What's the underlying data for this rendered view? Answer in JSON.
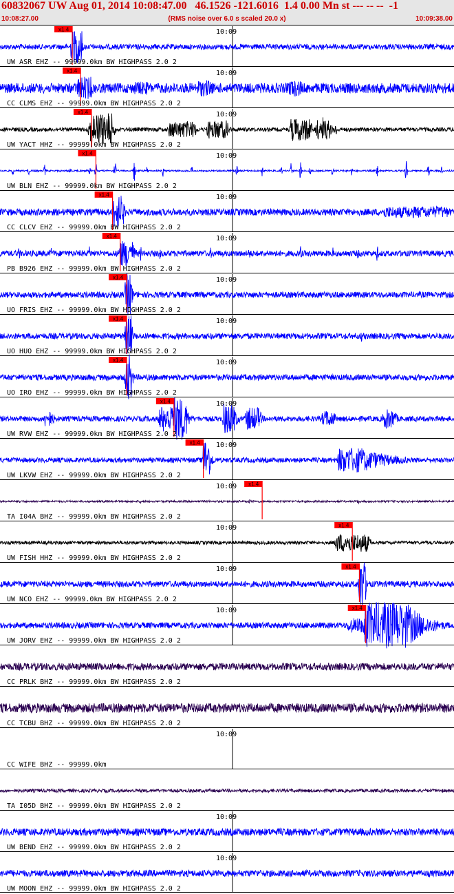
{
  "header": {
    "title": "60832067 UW Aug 01, 2014 10:08:47.00   46.1526 -121.6016  1.4 0.00 Mn st --- -- --  -1",
    "start_time": "10:08:27.00",
    "subtitle": "(RMS noise over 6.0 s scaled 20.0 x)",
    "end_time": "10:09:38.00"
  },
  "colors": {
    "trace_blue": "#0000ff",
    "trace_black": "#000000",
    "trace_purple": "#2a0050",
    "pick_red": "#ff0000",
    "header_text": "#cc0000"
  },
  "chart_data": {
    "type": "line",
    "x_unit": "time",
    "x_start": "10:08:27.00",
    "x_end": "10:09:38.00",
    "minute_mark_label": "10:09",
    "traces": [
      {
        "label": "UW ASR EHZ -- 99999.0km BW  HIGHPASS  2.0  2",
        "color": "blue",
        "pick": "x1.4",
        "pick_time_s": 11.3,
        "noise": 0.16,
        "bursts": [
          [
            11.2,
            1.6,
            1.0,
            6
          ]
        ],
        "spikes": []
      },
      {
        "label": "CC CLMS EHZ -- 99999.0km BW  HIGHPASS  2.0  2",
        "color": "blue",
        "pick": "x1.4",
        "pick_time_s": 12.6,
        "noise": 0.3,
        "bursts": [
          [
            12.2,
            2.0,
            0.7,
            2
          ],
          [
            21,
            2,
            0.4,
            1.5
          ],
          [
            31,
            2,
            0.5,
            1.5
          ],
          [
            45,
            2,
            0.5,
            1.5
          ]
        ],
        "spikes": []
      },
      {
        "label": "UW YACT HHZ -- 99999.0km BW  HIGHPASS  2.0  2",
        "color": "black",
        "pick": "x1.4",
        "pick_time_s": 14.3,
        "noise": 0.12,
        "bursts": [
          [
            14.0,
            3.5,
            1.0,
            2.5
          ],
          [
            26.5,
            4.0,
            0.5,
            3
          ],
          [
            32.5,
            3.0,
            0.55,
            2
          ],
          [
            45.5,
            3.0,
            0.7,
            3
          ],
          [
            49.5,
            2.0,
            0.6,
            2
          ]
        ],
        "spikes": [
          [
            50.5,
            0.9
          ],
          [
            52.5,
            0.6
          ]
        ]
      },
      {
        "label": "UW BLN EHZ -- 99999.0km BW  HIGHPASS  2.0  2",
        "color": "blue",
        "pick": "x1.4",
        "pick_time_s": 15.0,
        "noise": 0.05,
        "bursts": [],
        "spikes": [
          [
            2,
            0.3
          ],
          [
            4.5,
            0.3
          ],
          [
            7,
            0.4
          ],
          [
            11,
            0.3
          ],
          [
            14,
            0.3
          ],
          [
            15,
            0.6
          ],
          [
            18,
            0.8
          ],
          [
            21,
            0.8
          ],
          [
            23,
            0.3
          ],
          [
            25.5,
            0.4
          ],
          [
            30,
            0.3
          ],
          [
            37,
            0.4
          ],
          [
            41,
            0.4
          ],
          [
            44,
            0.3
          ],
          [
            45.5,
            0.5
          ],
          [
            47,
            0.7
          ],
          [
            48.5,
            0.4
          ],
          [
            52,
            0.4
          ],
          [
            55,
            0.3
          ],
          [
            59,
            0.6
          ],
          [
            63.5,
            1.0
          ],
          [
            67,
            0.5
          ],
          [
            69,
            0.4
          ]
        ]
      },
      {
        "label": "CC CLCV EHZ -- 99999.0km BW  HIGHPASS  2.0  2",
        "color": "blue",
        "pick": "x1.4",
        "pick_time_s": 17.6,
        "noise": 0.2,
        "bursts": [
          [
            17.7,
            1.5,
            1.0,
            3
          ],
          [
            60,
            10,
            0.35,
            5
          ]
        ],
        "spikes": []
      },
      {
        "label": "PB B926 EHZ -- 99999.0km BW  HIGHPASS  2.0  2",
        "color": "blue",
        "pick": "x1.4",
        "pick_time_s": 18.8,
        "noise": 0.18,
        "bursts": [
          [
            18.7,
            2.0,
            0.8,
            2
          ]
        ],
        "spikes": [
          [
            3,
            0.5
          ],
          [
            8,
            0.4
          ],
          [
            14,
            0.6
          ],
          [
            22,
            0.5
          ],
          [
            25,
            0.5
          ],
          [
            28,
            0.4
          ],
          [
            33,
            0.4
          ],
          [
            39,
            0.5
          ],
          [
            43,
            0.4
          ],
          [
            47,
            0.6
          ],
          [
            52,
            0.5
          ],
          [
            56,
            0.4
          ],
          [
            59,
            0.6
          ],
          [
            63,
            0.4
          ]
        ]
      },
      {
        "label": "UO FRIS EHZ -- 99999.0km BW  HIGHPASS  2.0  2",
        "color": "blue",
        "pick": "x1.4",
        "pick_time_s": 19.8,
        "noise": 0.18,
        "bursts": [
          [
            19.7,
            0.8,
            1.3,
            4
          ]
        ],
        "spikes": []
      },
      {
        "label": "UO HUO EHZ -- 99999.0km BW  HIGHPASS  2.0  2",
        "color": "blue",
        "pick": "x1.4",
        "pick_time_s": 19.8,
        "noise": 0.18,
        "bursts": [
          [
            19.7,
            0.8,
            1.3,
            4
          ]
        ],
        "spikes": [
          [
            56.5,
            0.4
          ]
        ]
      },
      {
        "label": "UO IRO EHZ -- 99999.0km BW  HIGHPASS  2.0  2",
        "color": "blue",
        "pick": "x1.4",
        "pick_time_s": 19.8,
        "noise": 0.18,
        "bursts": [
          [
            19.7,
            0.8,
            1.4,
            4
          ]
        ],
        "spikes": []
      },
      {
        "label": "UW RVW EHZ -- 99999.0km BW  HIGHPASS  2.0  2",
        "color": "blue",
        "pick": "x1.4",
        "pick_time_s": 27.2,
        "noise": 0.16,
        "bursts": [
          [
            7,
            1.0,
            0.5,
            1.5
          ],
          [
            25.0,
            3.0,
            0.8,
            2
          ],
          [
            27.0,
            2.0,
            1.3,
            2
          ],
          [
            35,
            1.5,
            0.9,
            1.5
          ],
          [
            38.5,
            2.0,
            0.7,
            2
          ],
          [
            50.5,
            1.5,
            0.5,
            1.5
          ],
          [
            60,
            1.5,
            0.6,
            1.5
          ]
        ],
        "spikes": []
      },
      {
        "label": "UW LKVW EHZ -- 99999.0km BW  HIGHPASS  2.0  2",
        "color": "blue",
        "pick": "x1.4",
        "pick_time_s": 31.8,
        "noise": 0.15,
        "bursts": [
          [
            31.8,
            0.8,
            1.3,
            2
          ],
          [
            53,
            3.5,
            0.75,
            0.2
          ]
        ],
        "spikes": []
      },
      {
        "label": "TA I04A BHZ -- 99999.0km BW  HIGHPASS  2.0  2",
        "color": "purple",
        "pick": "x1.4",
        "pick_time_s": 41.0,
        "noise": 0.06,
        "bursts": [],
        "spikes": [
          [
            3,
            0.2
          ],
          [
            10,
            0.15
          ],
          [
            22,
            0.15
          ],
          [
            39,
            0.2
          ],
          [
            56,
            0.2
          ]
        ]
      },
      {
        "label": "UW FISH HHZ -- 99999.0km BW  HIGHPASS  2.0  2",
        "color": "black",
        "pick": "x1.4",
        "pick_time_s": 55.1,
        "noise": 0.1,
        "bursts": [
          [
            52.5,
            5.0,
            0.55,
            2
          ]
        ],
        "spikes": []
      },
      {
        "label": "UW NCO EHZ -- 99999.0km BW  HIGHPASS  2.0  2",
        "color": "blue",
        "pick": "x1.4",
        "pick_time_s": 56.2,
        "noise": 0.18,
        "bursts": [
          [
            56.2,
            0.8,
            1.6,
            3
          ]
        ],
        "spikes": []
      },
      {
        "label": "UW JORV EHZ -- 99999.0km BW  HIGHPASS  2.0  2",
        "color": "blue",
        "pick": "x1.4",
        "pick_time_s": 57.2,
        "noise": 0.18,
        "bursts": [
          [
            57.0,
            6.5,
            1.4,
            0.3
          ],
          [
            54.5,
            3.0,
            0.45,
            1
          ]
        ],
        "spikes": []
      },
      {
        "label": "CC PRLK BHZ -- 99999.0km BW  HIGHPASS  2.0  2",
        "color": "purple",
        "pick": "",
        "pick_time_s": null,
        "noise": 0.22,
        "bursts": [],
        "spikes": [],
        "hide_minute": true
      },
      {
        "label": "CC TCBU BHZ -- 99999.0km BW  HIGHPASS  2.0  2",
        "color": "purple",
        "pick": "",
        "pick_time_s": null,
        "noise": 0.28,
        "bursts": [],
        "spikes": [],
        "hide_minute": true
      },
      {
        "label": "CC WIFE BHZ -- 99999.0km",
        "color": "none",
        "pick": "",
        "pick_time_s": null,
        "noise": 0,
        "bursts": [],
        "spikes": []
      },
      {
        "label": "TA I05D BHZ -- 99999.0km BW  HIGHPASS  2.0  2",
        "color": "purple",
        "pick": "",
        "pick_time_s": null,
        "noise": 0.1,
        "bursts": [],
        "spikes": [],
        "hide_minute": true
      },
      {
        "label": "UW BEND EHZ -- 99999.0km BW  HIGHPASS  2.0  2",
        "color": "blue",
        "pick": "",
        "pick_time_s": null,
        "noise": 0.22,
        "bursts": [],
        "spikes": []
      },
      {
        "label": "UW MOON EHZ -- 99999.0km BW  HIGHPASS  2.0  2",
        "color": "blue",
        "pick": "",
        "pick_time_s": null,
        "noise": 0.2,
        "bursts": [],
        "spikes": []
      }
    ]
  }
}
